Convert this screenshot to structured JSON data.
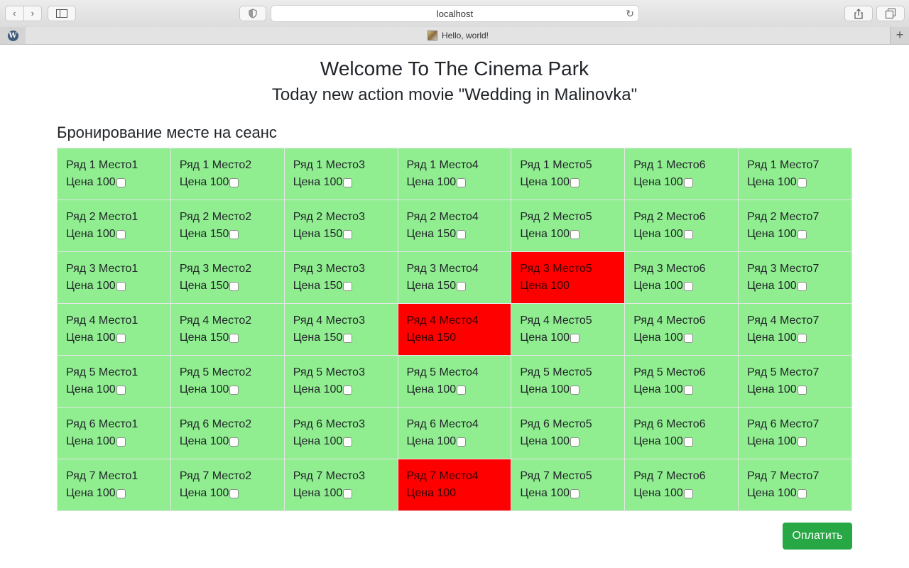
{
  "browser": {
    "url": "localhost",
    "tab_title": "Hello, world!",
    "wordpress_glyph": "W",
    "reload_glyph": "↻",
    "new_tab_glyph": "+"
  },
  "page": {
    "welcome": "Welcome To The Cinema Park",
    "subtitle": "Today new action movie \"Wedding in Malinovka\"",
    "section_title": "Бронирование месте на сеанс",
    "pay_button": "Оплатить"
  },
  "colors": {
    "available": "#90ee90",
    "booked": "#ff0000",
    "pay_button": "#28a745"
  },
  "seats": [
    [
      {
        "label": "Ряд 1 Место1",
        "price": "Цена 100",
        "booked": false
      },
      {
        "label": "Ряд 1 Место2",
        "price": "Цена 100",
        "booked": false
      },
      {
        "label": "Ряд 1 Место3",
        "price": "Цена 100",
        "booked": false
      },
      {
        "label": "Ряд 1 Место4",
        "price": "Цена 100",
        "booked": false
      },
      {
        "label": "Ряд 1 Место5",
        "price": "Цена 100",
        "booked": false
      },
      {
        "label": "Ряд 1 Место6",
        "price": "Цена 100",
        "booked": false
      },
      {
        "label": "Ряд 1 Место7",
        "price": "Цена 100",
        "booked": false
      }
    ],
    [
      {
        "label": "Ряд 2 Место1",
        "price": "Цена 100",
        "booked": false
      },
      {
        "label": "Ряд 2 Место2",
        "price": "Цена 150",
        "booked": false
      },
      {
        "label": "Ряд 2 Место3",
        "price": "Цена 150",
        "booked": false
      },
      {
        "label": "Ряд 2 Место4",
        "price": "Цена 150",
        "booked": false
      },
      {
        "label": "Ряд 2 Место5",
        "price": "Цена 100",
        "booked": false
      },
      {
        "label": "Ряд 2 Место6",
        "price": "Цена 100",
        "booked": false
      },
      {
        "label": "Ряд 2 Место7",
        "price": "Цена 100",
        "booked": false
      }
    ],
    [
      {
        "label": "Ряд 3 Место1",
        "price": "Цена 100",
        "booked": false
      },
      {
        "label": "Ряд 3 Место2",
        "price": "Цена 150",
        "booked": false
      },
      {
        "label": "Ряд 3 Место3",
        "price": "Цена 150",
        "booked": false
      },
      {
        "label": "Ряд 3 Место4",
        "price": "Цена 150",
        "booked": false
      },
      {
        "label": "Ряд 3 Место5",
        "price": "Цена 100",
        "booked": true
      },
      {
        "label": "Ряд 3 Место6",
        "price": "Цена 100",
        "booked": false
      },
      {
        "label": "Ряд 3 Место7",
        "price": "Цена 100",
        "booked": false
      }
    ],
    [
      {
        "label": "Ряд 4 Место1",
        "price": "Цена 100",
        "booked": false
      },
      {
        "label": "Ряд 4 Место2",
        "price": "Цена 150",
        "booked": false
      },
      {
        "label": "Ряд 4 Место3",
        "price": "Цена 150",
        "booked": false
      },
      {
        "label": "Ряд 4 Место4",
        "price": "Цена 150",
        "booked": true
      },
      {
        "label": "Ряд 4 Место5",
        "price": "Цена 100",
        "booked": false
      },
      {
        "label": "Ряд 4 Место6",
        "price": "Цена 100",
        "booked": false
      },
      {
        "label": "Ряд 4 Место7",
        "price": "Цена 100",
        "booked": false
      }
    ],
    [
      {
        "label": "Ряд 5 Место1",
        "price": "Цена 100",
        "booked": false
      },
      {
        "label": "Ряд 5 Место2",
        "price": "Цена 100",
        "booked": false
      },
      {
        "label": "Ряд 5 Место3",
        "price": "Цена 100",
        "booked": false
      },
      {
        "label": "Ряд 5 Место4",
        "price": "Цена 100",
        "booked": false
      },
      {
        "label": "Ряд 5 Место5",
        "price": "Цена 100",
        "booked": false
      },
      {
        "label": "Ряд 5 Место6",
        "price": "Цена 100",
        "booked": false
      },
      {
        "label": "Ряд 5 Место7",
        "price": "Цена 100",
        "booked": false
      }
    ],
    [
      {
        "label": "Ряд 6 Место1",
        "price": "Цена 100",
        "booked": false
      },
      {
        "label": "Ряд 6 Место2",
        "price": "Цена 100",
        "booked": false
      },
      {
        "label": "Ряд 6 Место3",
        "price": "Цена 100",
        "booked": false
      },
      {
        "label": "Ряд 6 Место4",
        "price": "Цена 100",
        "booked": false
      },
      {
        "label": "Ряд 6 Место5",
        "price": "Цена 100",
        "booked": false
      },
      {
        "label": "Ряд 6 Место6",
        "price": "Цена 100",
        "booked": false
      },
      {
        "label": "Ряд 6 Место7",
        "price": "Цена 100",
        "booked": false
      }
    ],
    [
      {
        "label": "Ряд 7 Место1",
        "price": "Цена 100",
        "booked": false
      },
      {
        "label": "Ряд 7 Место2",
        "price": "Цена 100",
        "booked": false
      },
      {
        "label": "Ряд 7 Место3",
        "price": "Цена 100",
        "booked": false
      },
      {
        "label": "Ряд 7 Место4",
        "price": "Цена 100",
        "booked": true
      },
      {
        "label": "Ряд 7 Место5",
        "price": "Цена 100",
        "booked": false
      },
      {
        "label": "Ряд 7 Место6",
        "price": "Цена 100",
        "booked": false
      },
      {
        "label": "Ряд 7 Место7",
        "price": "Цена 100",
        "booked": false
      }
    ]
  ]
}
